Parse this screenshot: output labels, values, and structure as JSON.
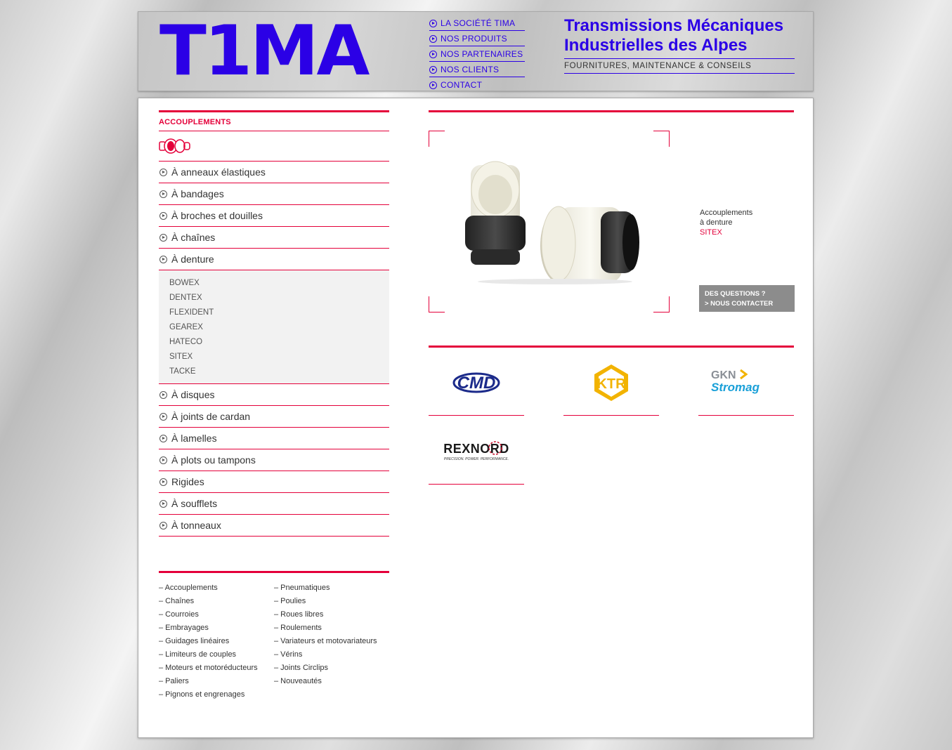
{
  "header": {
    "logo": "T1MA",
    "nav": [
      {
        "label": "LA SOCIÉTÉ TIMA"
      },
      {
        "label": "NOS PRODUITS"
      },
      {
        "label": "NOS PARTENAIRES"
      },
      {
        "label": "NOS CLIENTS"
      },
      {
        "label": "CONTACT"
      }
    ],
    "tagline_line1": "Transmissions Mécaniques",
    "tagline_line2": "Industrielles des Alpes",
    "tagline_sub": "FOURNITURES, MAINTENANCE & CONSEILS"
  },
  "sidebar": {
    "category_title": "ACCOUPLEMENTS",
    "items_before": [
      {
        "label": "À anneaux élastiques"
      },
      {
        "label": "À bandages"
      },
      {
        "label": "À broches et douilles"
      },
      {
        "label": "À chaînes"
      },
      {
        "label": "À denture"
      }
    ],
    "submenu": [
      "BOWEX",
      "DENTEX",
      "FLEXIDENT",
      "GEAREX",
      "HATECO",
      "SITEX",
      "TACKE"
    ],
    "items_after": [
      {
        "label": "À disques"
      },
      {
        "label": "À joints de cardan"
      },
      {
        "label": "À lamelles"
      },
      {
        "label": "À plots ou tampons"
      },
      {
        "label": "Rigides"
      },
      {
        "label": "À soufflets"
      },
      {
        "label": "À tonneaux"
      }
    ]
  },
  "sitemap": {
    "col1": [
      "– Accouplements",
      "– Chaînes",
      "– Courroies",
      "– Embrayages",
      "– Guidages linéaires",
      "– Limiteurs de couples",
      "– Moteurs et motoréducteurs",
      "– Paliers",
      "– Pignons et engrenages"
    ],
    "col2": [
      "– Pneumatiques",
      "– Poulies",
      "– Roues libres",
      "– Roulements",
      "– Variateurs et motovariateurs",
      "– Vérins",
      "– Joints Circlips",
      "– Nouveautés"
    ]
  },
  "hero": {
    "caption_line1": "Accouplements",
    "caption_line2": "à denture",
    "caption_brand": "SITEX",
    "contact_line1": "DES QUESTIONS ?",
    "contact_line2": "> NOUS CONTACTER"
  },
  "brands": {
    "cmd": "CMD",
    "ktr": "KTR",
    "gkn_top": "GKN",
    "gkn_bottom": "Stromag",
    "rexnord": "REXNORD",
    "rexnord_tag": "PRECISION. POWER. PERFORMANCE."
  },
  "colors": {
    "accent_red": "#e4003a",
    "brand_blue": "#2b00e6",
    "ktr_yellow": "#f2b300"
  }
}
